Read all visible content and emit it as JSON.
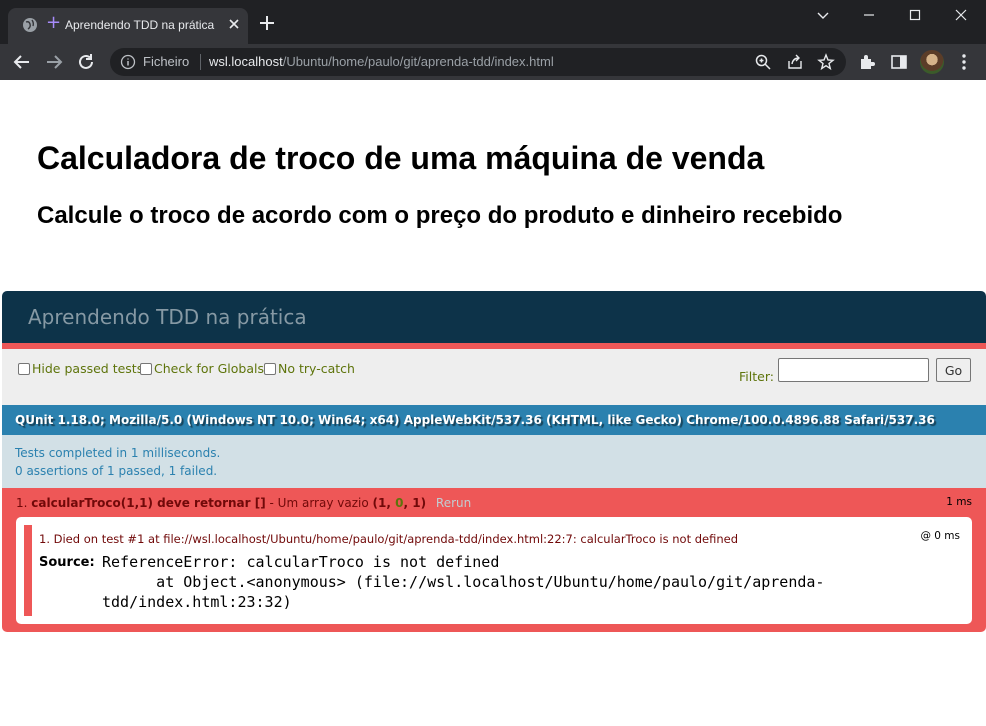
{
  "browser": {
    "tab": {
      "title": "Aprendendo TDD na prática"
    },
    "address": {
      "scheme": "Ficheiro",
      "host": "wsl.localhost",
      "path": "/Ubuntu/home/paulo/git/aprenda-tdd/index.html"
    },
    "icons": [
      "globe-icon",
      "close-icon",
      "plus-icon",
      "back-icon",
      "forward-icon",
      "reload-icon",
      "info-icon",
      "zoom-icon",
      "share-icon",
      "star-icon",
      "extensions-icon",
      "sidepanel-icon",
      "menu-icon"
    ]
  },
  "page": {
    "heading": "Calculadora de troco de uma máquina de venda",
    "subheading": "Calcule o troco de acordo com o preço do produto e dinheiro recebido"
  },
  "qunit": {
    "header": "Aprendendo TDD na prática",
    "toolbar": {
      "hide_passed": "Hide passed tests",
      "check_globals": "Check for Globals",
      "no_try_catch": "No try-catch",
      "filter_label": "Filter:",
      "filter_value": "",
      "go_label": "Go"
    },
    "user_agent": "QUnit 1.18.0; Mozilla/5.0 (Windows NT 10.0; Win64; x64) AppleWebKit/537.36 (KHTML, like Gecko) Chrome/100.0.4896.88 Safari/537.36",
    "result_line1": "Tests completed in 1 milliseconds.",
    "result_line2": "0 assertions of 1 passed, 1 failed.",
    "test": {
      "index": "1.",
      "name": "calcularTroco(1,1) deve retornar []",
      "suffix": " - Um array vazio",
      "failed": "1",
      "passed": "0",
      "total": "1",
      "rerun": "Rerun",
      "runtime": "1 ms",
      "assertion": {
        "message": "1. Died on test #1     at file://wsl.localhost/Ubuntu/home/paulo/git/aprenda-tdd/index.html:22:7: calcularTroco is not defined",
        "time": "@ 0 ms",
        "source_label": "Source:",
        "source": "ReferenceError: calcularTroco is not defined\n      at Object.<anonymous> (file://wsl.localhost/Ubuntu/home/paulo/git/aprenda-\ntdd/index.html:23:32)"
      }
    }
  },
  "colors": {
    "qunit_header": "#0d3349",
    "fail_red": "#ee5757",
    "ua_blue": "#2b81af",
    "result_bg": "#d2e0e6"
  }
}
